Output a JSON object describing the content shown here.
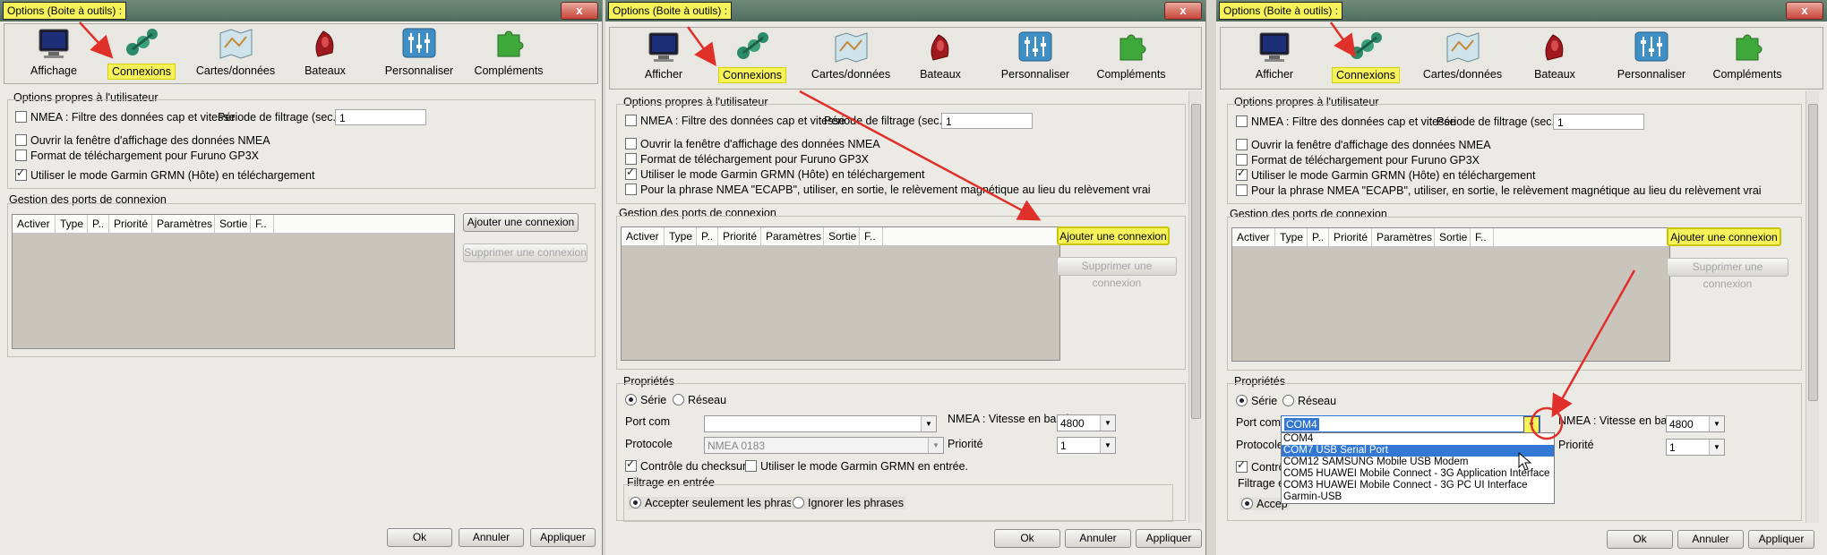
{
  "title": "Options (Boite à outils) :",
  "close_label": "x",
  "tabs": {
    "affichage": "Affichage",
    "afficher": "Afficher",
    "connexions": "Connexions",
    "cartes": "Cartes/données",
    "bateaux": "Bateaux",
    "personnaliser": "Personnaliser",
    "complements": "Compléments"
  },
  "user_options": {
    "heading": "Options propres à l'utilisateur",
    "nmea_filter": "NMEA : Filtre des données cap et vitesse",
    "filter_period_label": "Période de filtrage (sec.)",
    "filter_period_value": "1",
    "open_nmea_window": "Ouvrir la fenêtre d'affichage des données NMEA",
    "furuno_format": "Format de téléchargement pour Furuno GP3X",
    "garmin_mode": "Utiliser le mode Garmin GRMN (Hôte) en téléchargement",
    "ecapb": "Pour la phrase NMEA \"ECAPB\", utiliser, en sortie, le relèvement magnétique  au lieu du relèvement vrai"
  },
  "ports": {
    "heading": "Gestion des ports de connexion",
    "columns": [
      "Activer",
      "Type",
      "P..",
      "Priorité",
      "Paramètres",
      "Sortie",
      "F.."
    ],
    "add_button": "Ajouter une connexion",
    "remove_button": "Supprimer une connexion"
  },
  "properties": {
    "heading": "Propriétés",
    "serial": "Série",
    "network": "Réseau",
    "port_label": "Port com",
    "port_value": "COM4",
    "baud_label": "NMEA : Vitesse en baud",
    "baud_value": "4800",
    "protocol_label": "Protocole",
    "protocol_value": "NMEA 0183",
    "priority_label": "Priorité",
    "priority_value": "1",
    "checksum": "Contrôle du checksum",
    "checksum_short": "Contrô",
    "garmin_output": "Utiliser le mode Garmin GRMN en entrée.",
    "input_filter": "Filtrage en entrée",
    "input_filter_short": "Filtrage e",
    "accept_only": "Accepter seulement les phrases",
    "accept_short": "Accep",
    "ignore": "Ignorer les phrases"
  },
  "port_options": [
    "COM4",
    "COM7 USB Serial Port",
    "COM12 SAMSUNG Mobile USB Modem",
    "COM5 HUAWEI Mobile Connect - 3G Application Interface",
    "COM3 HUAWEI Mobile Connect - 3G PC UI Interface",
    "Garmin-USB"
  ],
  "footer": {
    "ok": "Ok",
    "cancel": "Annuler",
    "apply": "Appliquer"
  },
  "colors": {
    "highlight": "#f6f35a",
    "arrow": "#e0302a",
    "selection": "#3478d6"
  }
}
